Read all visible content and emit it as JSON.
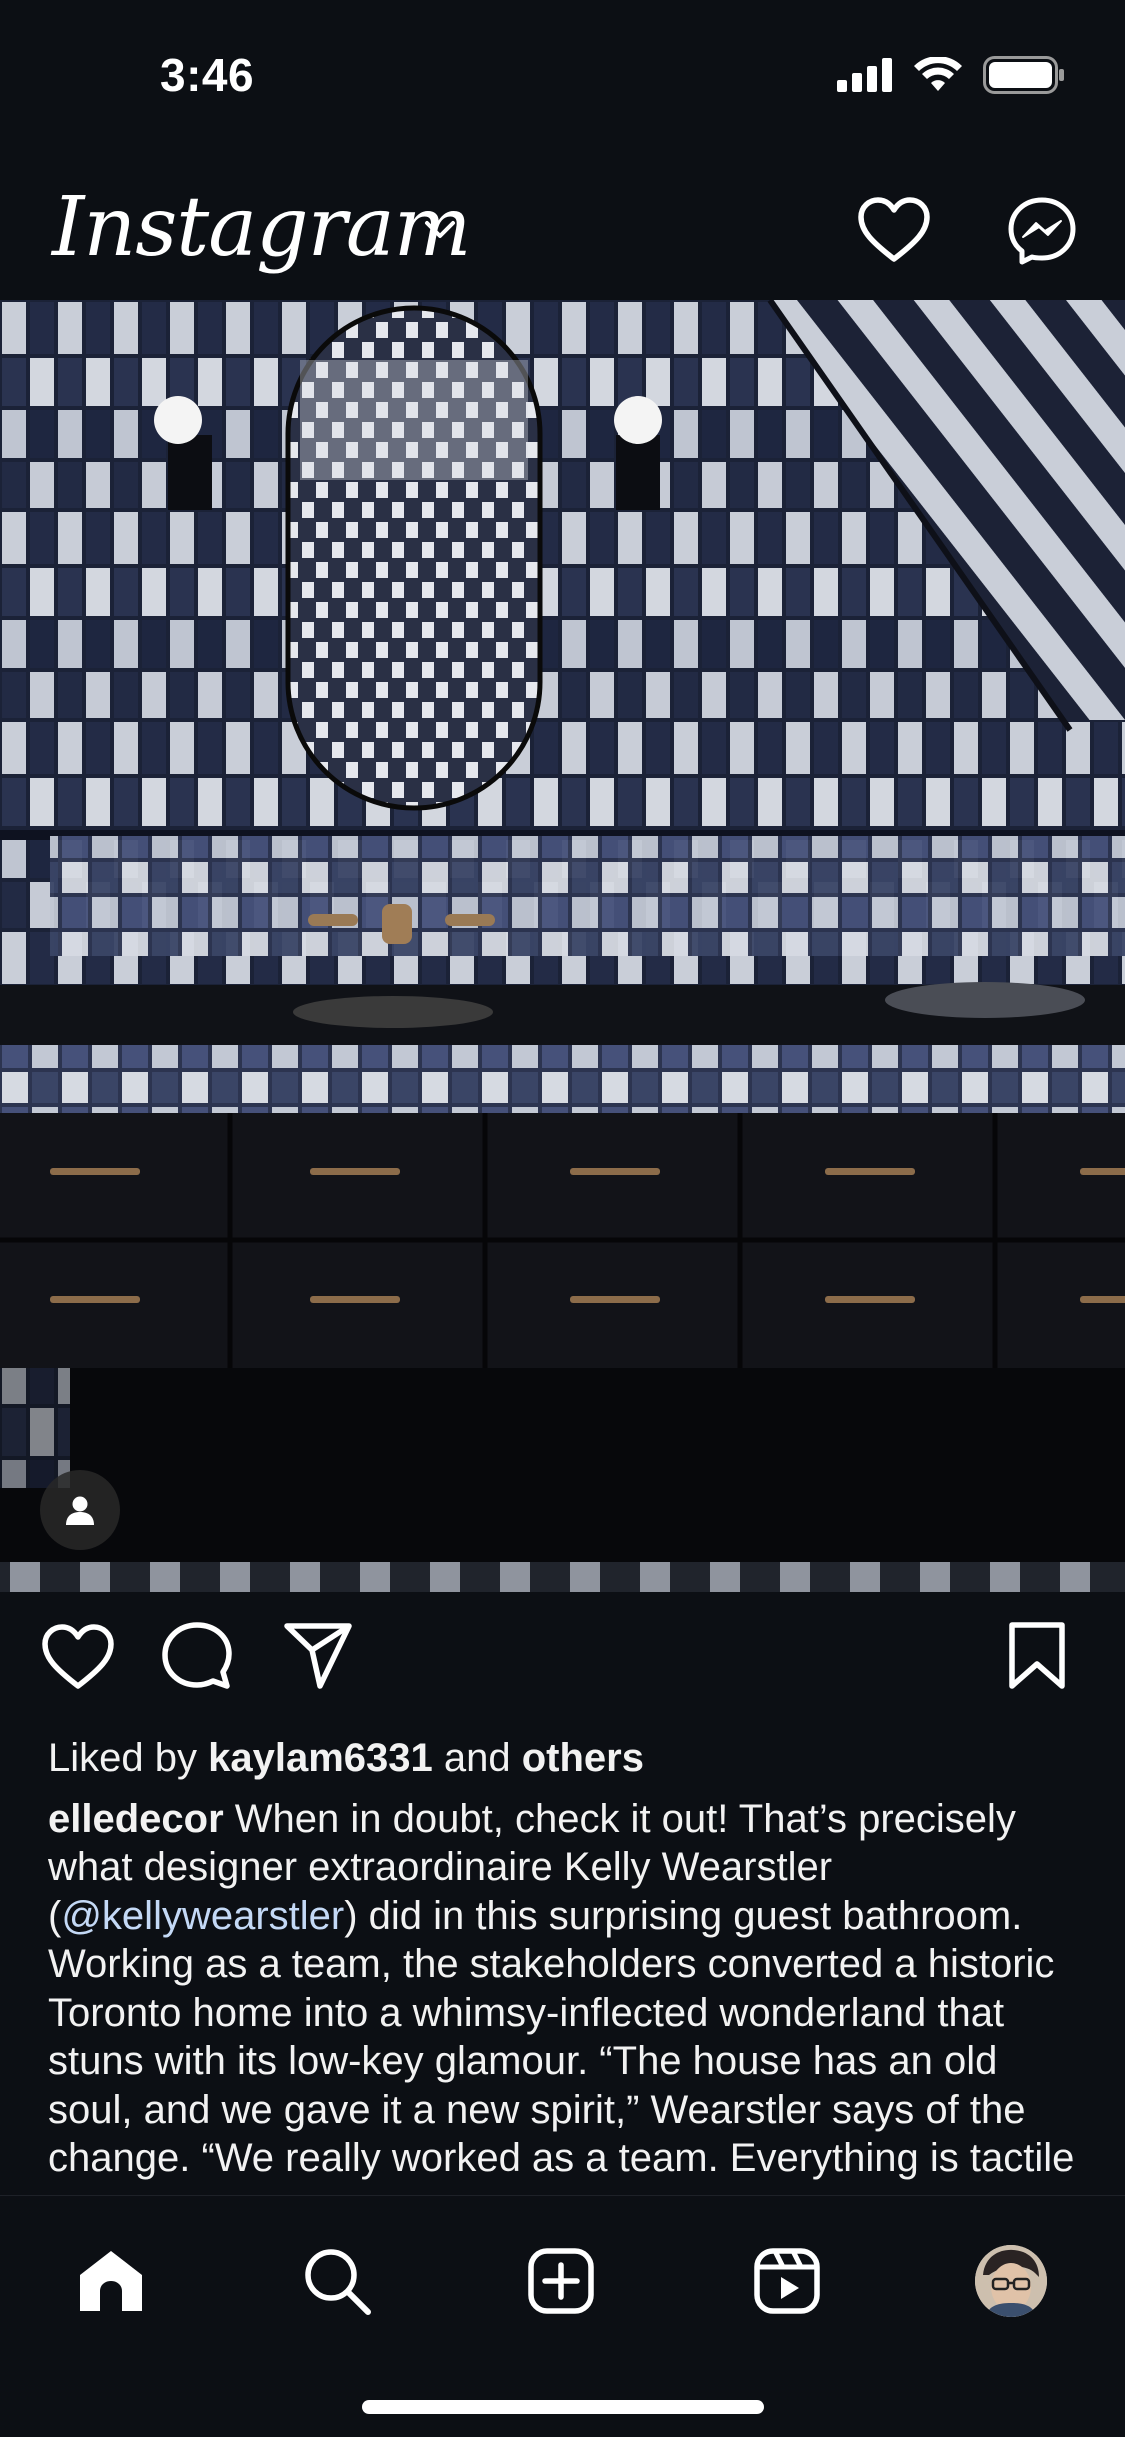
{
  "status_bar": {
    "time": "3:46"
  },
  "header": {
    "app_name": "Instagram"
  },
  "post": {
    "liked_by_prefix": "Liked by ",
    "liked_by_user": "kaylam6331",
    "liked_by_middle": " and ",
    "liked_by_others": "others",
    "author": "elledecor",
    "caption_part1": " When in doubt, check it out! That’s precisely what designer extraordinaire Kelly Wearstler (",
    "mention": "@kellywearstler",
    "caption_part2": ") did in this surprising guest bathroom. Working as a team, the stakeholders converted a historic Toronto home into a whimsy-inflected wonderland that stuns with its low-key glamour. “The house has an old soul, and we gave it a new spirit,” Wearstler says of the change. “We really worked as a team. Everything is tactile"
  },
  "icons": {
    "header": [
      "heart-icon",
      "messenger-icon",
      "chevron-down-icon"
    ],
    "actions": [
      "like-icon",
      "comment-icon",
      "share-icon",
      "bookmark-icon"
    ],
    "tabbar": [
      "home-icon",
      "search-icon",
      "create-icon",
      "reels-icon",
      "profile-avatar"
    ]
  },
  "colors": {
    "background": "#0c0f14",
    "text": "#f2f2f2",
    "mention": "#c4d9f6"
  }
}
